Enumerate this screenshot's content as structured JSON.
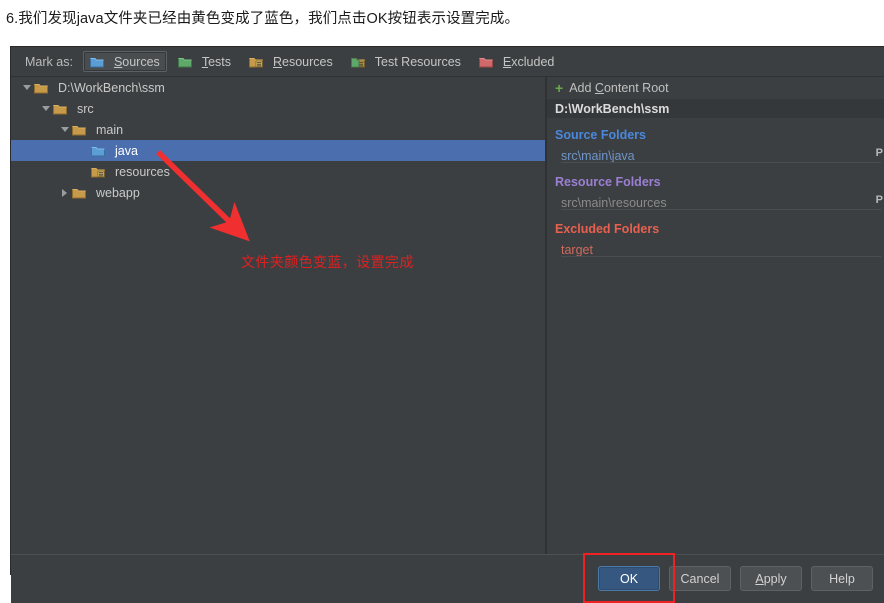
{
  "caption": "6.我们发现java文件夹已经由黄色变成了蓝色，我们点击OK按钮表示设置完成。",
  "dialog": {
    "mark_as": {
      "label": "Mark as:",
      "buttons": [
        {
          "label": "Sources",
          "mnemonic": "S",
          "rest": "ources",
          "icon": "folder-blue-icon",
          "active": true
        },
        {
          "label": "Tests",
          "mnemonic": "T",
          "rest": "ests",
          "icon": "folder-green-icon",
          "active": false
        },
        {
          "label": "Resources",
          "mnemonic": "R",
          "rest": "esources",
          "icon": "folder-yellow-lines-icon",
          "active": false
        },
        {
          "label": "Test Resources",
          "mnemonic": "",
          "rest": "Test Resources",
          "icon": "folder-green-yellow-lines-icon",
          "active": false
        },
        {
          "label": "Excluded",
          "mnemonic": "E",
          "rest": "xcluded",
          "icon": "folder-red-icon",
          "active": false
        }
      ]
    },
    "tree": [
      {
        "label": "D:\\WorkBench\\ssm",
        "depth": 0,
        "twisty": "down",
        "icon": "folder-yellow-icon",
        "selected": false
      },
      {
        "label": "src",
        "depth": 1,
        "twisty": "down",
        "icon": "folder-yellow-icon",
        "selected": false
      },
      {
        "label": "main",
        "depth": 2,
        "twisty": "down",
        "icon": "folder-yellow-icon",
        "selected": false
      },
      {
        "label": "java",
        "depth": 3,
        "twisty": "none",
        "icon": "folder-blue-icon",
        "selected": true
      },
      {
        "label": "resources",
        "depth": 3,
        "twisty": "none",
        "icon": "folder-yellow-lines-icon",
        "selected": false
      },
      {
        "label": "webapp",
        "depth": 2,
        "twisty": "right",
        "icon": "folder-yellow-icon",
        "selected": false
      }
    ],
    "detail": {
      "add_content_root": {
        "prefix": "Add ",
        "mnemonic": "C",
        "rest": "ontent Root",
        "plus": "+"
      },
      "content_root": "D:\\WorkBench\\ssm",
      "groups": [
        {
          "kind": "src",
          "heading": "Source Folders",
          "items": [
            {
              "path": "src\\main\\java",
              "mark": "P"
            }
          ]
        },
        {
          "kind": "res",
          "heading": "Resource Folders",
          "items": [
            {
              "path": "src\\main\\resources",
              "mark": "P"
            }
          ]
        },
        {
          "kind": "exc",
          "heading": "Excluded Folders",
          "items": [
            {
              "path": "target",
              "mark": ""
            }
          ]
        }
      ]
    },
    "footer": {
      "buttons": [
        {
          "name": "ok",
          "label": "OK",
          "mnemonic": "",
          "rest": "OK",
          "primary": true,
          "highlighted": true
        },
        {
          "name": "cancel",
          "label": "Cancel",
          "mnemonic": "",
          "rest": "Cancel",
          "primary": false,
          "highlighted": false
        },
        {
          "name": "apply",
          "label": "Apply",
          "mnemonic": "A",
          "rest": "pply",
          "primary": false,
          "highlighted": false
        },
        {
          "name": "help",
          "label": "Help",
          "mnemonic": "",
          "rest": "Help",
          "primary": false,
          "highlighted": false
        }
      ]
    }
  },
  "annotations": {
    "note": "文件夹颜色变蓝，设置完成",
    "note_color": "#e02020",
    "arrow_color": "#f03030",
    "highlight_color": "#ee2222"
  },
  "colors": {
    "dialog_bg": "#3c3f41",
    "selection_blue": "#4b6eaf",
    "source_heading": "#4a88dd",
    "resource_heading": "#9b7fd4",
    "excluded_heading": "#e8604f",
    "primary_button": "#365880"
  }
}
